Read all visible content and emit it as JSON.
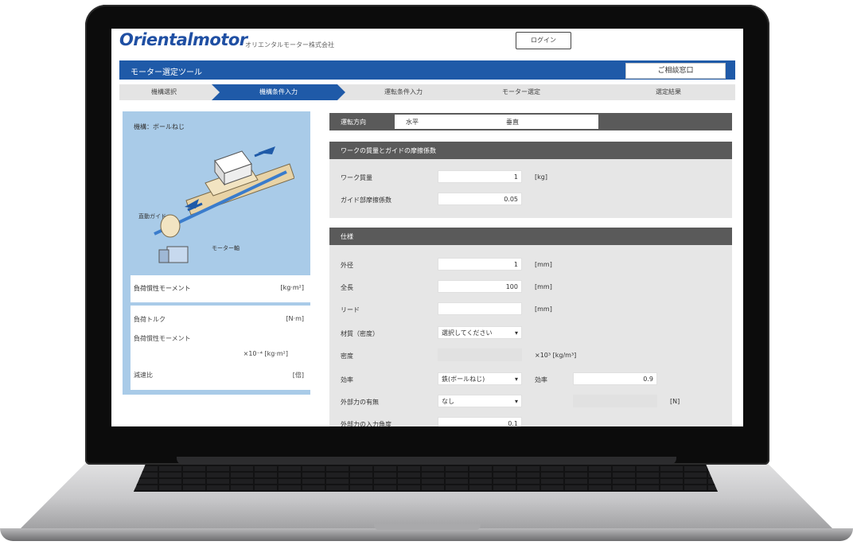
{
  "header": {
    "logo": "Orientalmotor",
    "tagline": "オリエンタルモーター株式会社",
    "login_label": "ログイン"
  },
  "titlebar": {
    "title": "モーター選定ツール",
    "contact_label": "ご相談窓口"
  },
  "steps": [
    "機構選択",
    "機構条件入力",
    "運転条件入力",
    "モーター選定",
    "選定結果"
  ],
  "left_panel": {
    "title": "機構：ボールねじ",
    "label_guide": "直動ガイド",
    "label_motor": "モーター軸",
    "result1": {
      "label": "負荷慣性モーメント",
      "value": "[kg·m²]"
    },
    "result2": {
      "row1_label": "負荷トルク",
      "row1_unit": "[N·m]",
      "row2_label": "負荷慣性モーメント",
      "row2_unit": "×10⁻⁴ [kg·m²]",
      "row3_label": "減速比",
      "row3_unit": "[倍]"
    }
  },
  "form": {
    "top": {
      "label": "運転方向",
      "opt1": "水平",
      "opt2": "垂直"
    },
    "section1": {
      "title": "ワークの質量とガイドの摩擦係数",
      "fields": [
        {
          "label": "ワーク質量",
          "value": "1",
          "unit": "[kg]"
        },
        {
          "label": "ガイド部摩擦係数",
          "value": "0.05",
          "unit": ""
        }
      ]
    },
    "section2": {
      "title": "仕様",
      "fields": [
        {
          "label": "外径",
          "value": "1",
          "unit": "[mm]"
        },
        {
          "label": "全長",
          "value": "100",
          "unit": "[mm]"
        },
        {
          "label": "リード",
          "value": "",
          "unit": "[mm]"
        },
        {
          "label": "材質（密度）",
          "value": "選択してください",
          "unit": ""
        },
        {
          "label": "密度",
          "value": "",
          "unit": "×10³ [kg/m³]"
        },
        {
          "label": "効率",
          "value": "鉄(ボールねじ)",
          "unit": "",
          "extra_label": "効率",
          "extra_value": "0.9"
        },
        {
          "label": "外部力の有無",
          "value": "なし",
          "unit": "[N]"
        },
        {
          "label": "外部力の入力角度",
          "value": "0.1",
          "unit": ""
        }
      ]
    }
  },
  "colors": {
    "brand_blue": "#1f5aa8",
    "panel_blue": "#a9cbe8",
    "section_bar": "#5a5a5a"
  }
}
